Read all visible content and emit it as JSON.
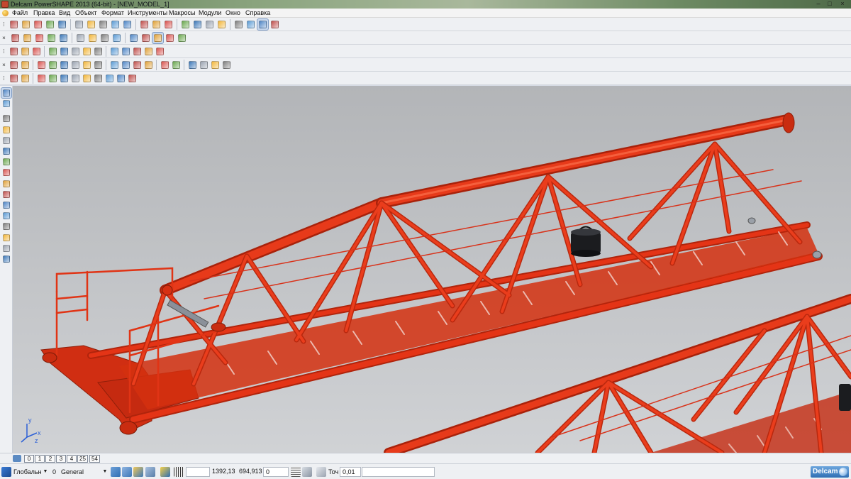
{
  "window": {
    "title": "Delcam PowerSHAPE 2013 (64-bit) - [NEW_MODEL_1]",
    "controls": [
      "–",
      "□",
      "×"
    ]
  },
  "menu": {
    "items": [
      "Файл",
      "Правка",
      "Вид",
      "Объект",
      "Формат",
      "Инструменты",
      "Макросы",
      "Модули",
      "Окно",
      "Справка"
    ]
  },
  "toolbars": {
    "row1_icons": [
      "new-file-icon",
      "open-file-icon",
      "open-model-icon",
      "save-icon",
      "save-as-icon",
      "cut-icon",
      "copy-icon",
      "paste-icon",
      "delete-icon",
      "delete-all-icon",
      "undo-icon",
      "redo-icon",
      "measure-icon",
      "select-icon",
      "curve-icon",
      "circle-icon",
      "arc-icon",
      "shading-icon",
      "settings-icon",
      "view-options-icon",
      "magic-wand-icon"
    ],
    "row2_icons": [
      "view-top-icon",
      "view-front-icon",
      "view-iso-icon",
      "view-box-icon",
      "view-rotate-icon",
      "zoom-window-icon",
      "zoom-fit-icon",
      "zoom-in-icon",
      "zoom-out-icon",
      "zoom-pan-icon",
      "target-icon",
      "shade-icon",
      "lightbulb-icon",
      "hand-icon"
    ],
    "row3_icons": [
      "doc-icon",
      "doc-list-icon",
      "layer-icon",
      "surface-icon",
      "solid-sphere-icon",
      "red-sphere-icon",
      "play-icon",
      "arrow-icon",
      "box-icon",
      "frame-icon",
      "info-icon",
      "layers-icon",
      "morph-icon"
    ],
    "row4_icons": [
      "wireframe-icon",
      "shaded-icon",
      "surface-a-icon",
      "surface-b-icon",
      "surface-c-icon",
      "surface-d-icon",
      "surface-e-icon",
      "surface-f-icon",
      "solid-a-icon",
      "solid-b-icon",
      "solid-c-icon",
      "solid-d-icon",
      "mesh-icon",
      "mesh-b-icon",
      "mesh-c-icon",
      "mesh-d-icon",
      "mesh-e-icon",
      "mesh-f-icon"
    ],
    "row5_icons": [
      "select-all-icon",
      "axis-icon",
      "cube-icon",
      "blank-icon",
      "shade-cube-icon",
      "group-icon",
      "ungroup-icon",
      "image-icon",
      "flag-icon",
      "pattern-icon",
      "light-icon"
    ]
  },
  "left_tools": [
    "pointer-icon",
    "wizard-icon",
    "copy-a-icon",
    "copy-b-icon",
    "copy-c-icon",
    "transform-icon",
    "mirror-icon",
    "surface-tool-icon",
    "solid-tool-icon",
    "mesh-tool-icon",
    "feature-icon",
    "extrude-icon",
    "revolve-icon",
    "blend-icon",
    "fillet-icon",
    "boolean-icon"
  ],
  "level_tabs": [
    "0",
    "1",
    "2",
    "3",
    "4",
    "25",
    "54"
  ],
  "status": {
    "workplane": "Глобальн",
    "level_number": "0",
    "level_name": "General",
    "coord_x": "1392,13",
    "coord_y": "694,913",
    "coord_z": "0",
    "tolerance_label": "Точ",
    "tolerance_value": "0,01",
    "command_input": ""
  },
  "brand": "Delcam",
  "axis_labels": {
    "x": "x",
    "y": "y",
    "z": "z"
  },
  "colors": {
    "model_red": "#e43416",
    "model_red_dark": "#b0240c",
    "model_red_light": "#ff6a44",
    "ui_accent": "#2f6fb4"
  }
}
